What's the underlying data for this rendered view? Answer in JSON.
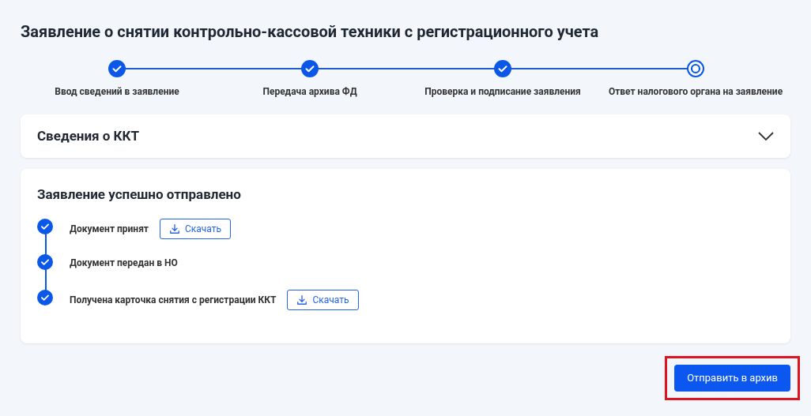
{
  "title": "Заявление о снятии контрольно-кассовой техники с регистрационного учета",
  "steps": [
    {
      "label": "Ввод сведений в заявление",
      "kind": "done"
    },
    {
      "label": "Передача архива ФД",
      "kind": "done"
    },
    {
      "label": "Проверка и подписание заявления",
      "kind": "done"
    },
    {
      "label": "Ответ налогового органа на заявление",
      "kind": "current"
    }
  ],
  "kkt_section": {
    "title": "Сведения о ККТ",
    "expanded": false
  },
  "result": {
    "title": "Заявление успешно отправлено",
    "items": [
      {
        "label": "Документ принят",
        "checked": true,
        "button": "Скачать"
      },
      {
        "label": "Документ передан в НО",
        "checked": true
      },
      {
        "label": "Получена карточка снятия с регистрации ККТ",
        "checked": true,
        "button": "Скачать"
      }
    ]
  },
  "archive_button": {
    "label": "Отправить в архив",
    "highlighted": true
  }
}
